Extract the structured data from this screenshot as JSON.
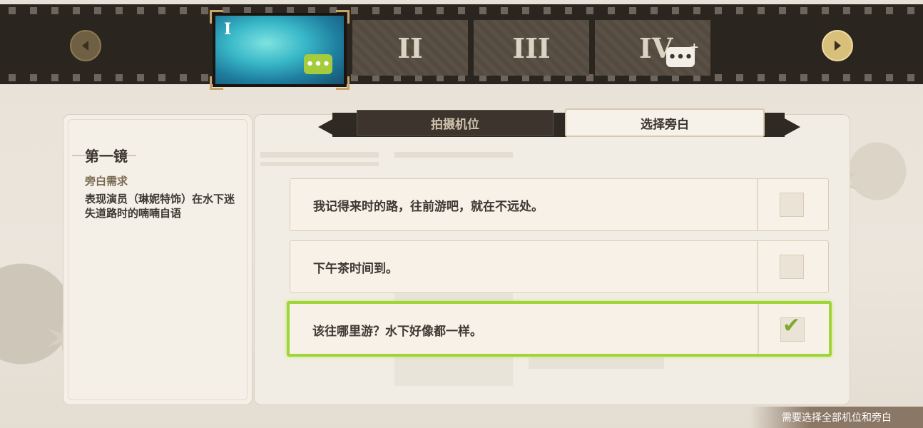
{
  "film_strip": {
    "prev_icon": "chevron-left-icon",
    "next_icon": "chevron-right-icon",
    "frames": [
      {
        "label": "I",
        "active": true,
        "bubble_icon": "speech-bubble-icon",
        "bubble_text": "•••"
      },
      {
        "label": "II",
        "active": false
      },
      {
        "label": "III",
        "active": false
      },
      {
        "label": "IV",
        "active": false,
        "bubble_icon": "add-speech-bubble-icon",
        "bubble_text": "•••",
        "plus": "+"
      }
    ]
  },
  "left_panel": {
    "shot_title": "第一镜",
    "requirement_label": "旁白需求",
    "requirement_text": "表现演员（琳妮特饰）在水下迷失道路时的喃喃自语"
  },
  "tabs": {
    "camera": "拍摄机位",
    "narration": "选择旁白",
    "selected": "narration"
  },
  "options": [
    {
      "text": "我记得来时的路，往前游吧，就在不远处。",
      "checked": false
    },
    {
      "text": "下午茶时间到。",
      "checked": false
    },
    {
      "text": "该往哪里游？水下好像都一样。",
      "checked": true
    }
  ],
  "check_symbol": "✔",
  "hint": "需要选择全部机位和旁白",
  "colors": {
    "film": "#2b2520",
    "selected_border": "#9fd43a",
    "accent_gold": "#d8c07a"
  }
}
